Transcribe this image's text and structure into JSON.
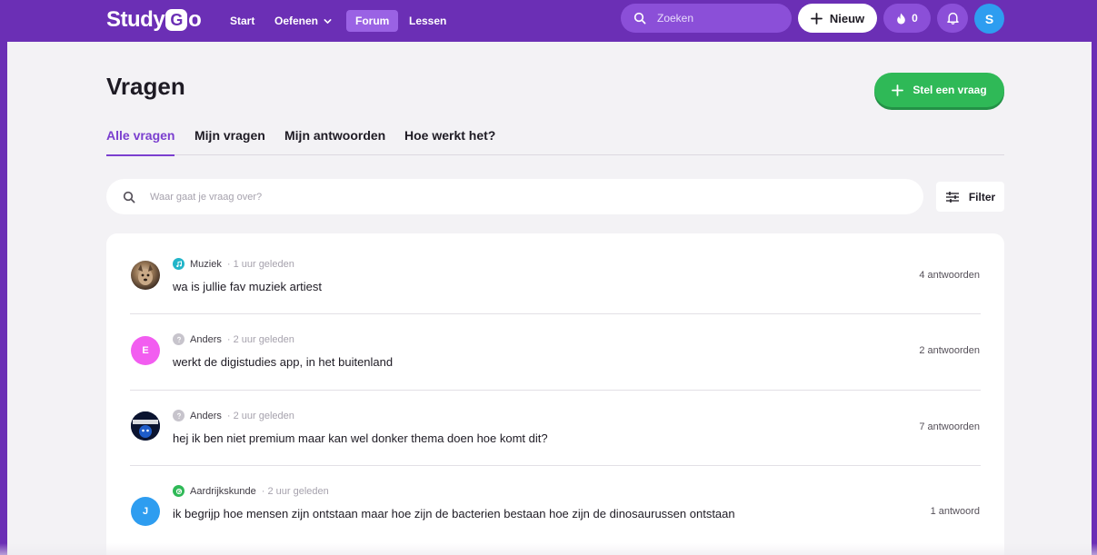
{
  "nav": {
    "logo_left": "Study",
    "logo_g": "G",
    "logo_right": "o",
    "links": {
      "start": "Start",
      "oefenen": "Oefenen",
      "forum": "Forum",
      "lessen": "Lessen"
    },
    "search_placeholder": "Zoeken",
    "new_button": "Nieuw",
    "streak_count": "0",
    "user_initial": "S"
  },
  "page": {
    "title": "Vragen",
    "ask_button": "Stel een vraag"
  },
  "tabs": [
    {
      "label": "Alle vragen",
      "active": true
    },
    {
      "label": "Mijn vragen",
      "active": false
    },
    {
      "label": "Mijn antwoorden",
      "active": false
    },
    {
      "label": "Hoe werkt het?",
      "active": false
    }
  ],
  "search": {
    "placeholder": "Waar gaat je vraag over?",
    "filter_label": "Filter"
  },
  "questions": [
    {
      "avatar_type": "photo-dog",
      "avatar_initial": "",
      "subject": "Muziek",
      "subject_color": "#22b5c9",
      "time": "· 1 uur geleden",
      "text": "wa is jullie fav muziek artiest",
      "answers": "4 antwoorden"
    },
    {
      "avatar_type": "initial",
      "avatar_initial": "E",
      "avatar_color": "#f25df0",
      "subject": "Anders",
      "subject_color": "#c7c4cc",
      "time": "· 2 uur geleden",
      "text": "werkt de digistudies app, in het buitenland",
      "answers": "2 antwoorden"
    },
    {
      "avatar_type": "photo-meme",
      "avatar_initial": "",
      "subject": "Anders",
      "subject_color": "#c7c4cc",
      "time": "· 2 uur geleden",
      "text": "hej ik ben niet premium maar kan wel donker thema doen hoe komt dit?",
      "answers": "7 antwoorden"
    },
    {
      "avatar_type": "initial",
      "avatar_initial": "J",
      "avatar_color": "#2e9df0",
      "subject": "Aardrijkskunde",
      "subject_color": "#2fb957",
      "time": "· 2 uur geleden",
      "text": "ik begrijp hoe mensen zijn ontstaan maar hoe zijn de bacterien bestaan hoe zijn de dinosaurussen ontstaan",
      "answers": "1 antwoord"
    }
  ],
  "colors": {
    "brand_purple": "#6b2fb5",
    "active_tab": "#7b3fcf",
    "ask_green": "#2fb957"
  }
}
